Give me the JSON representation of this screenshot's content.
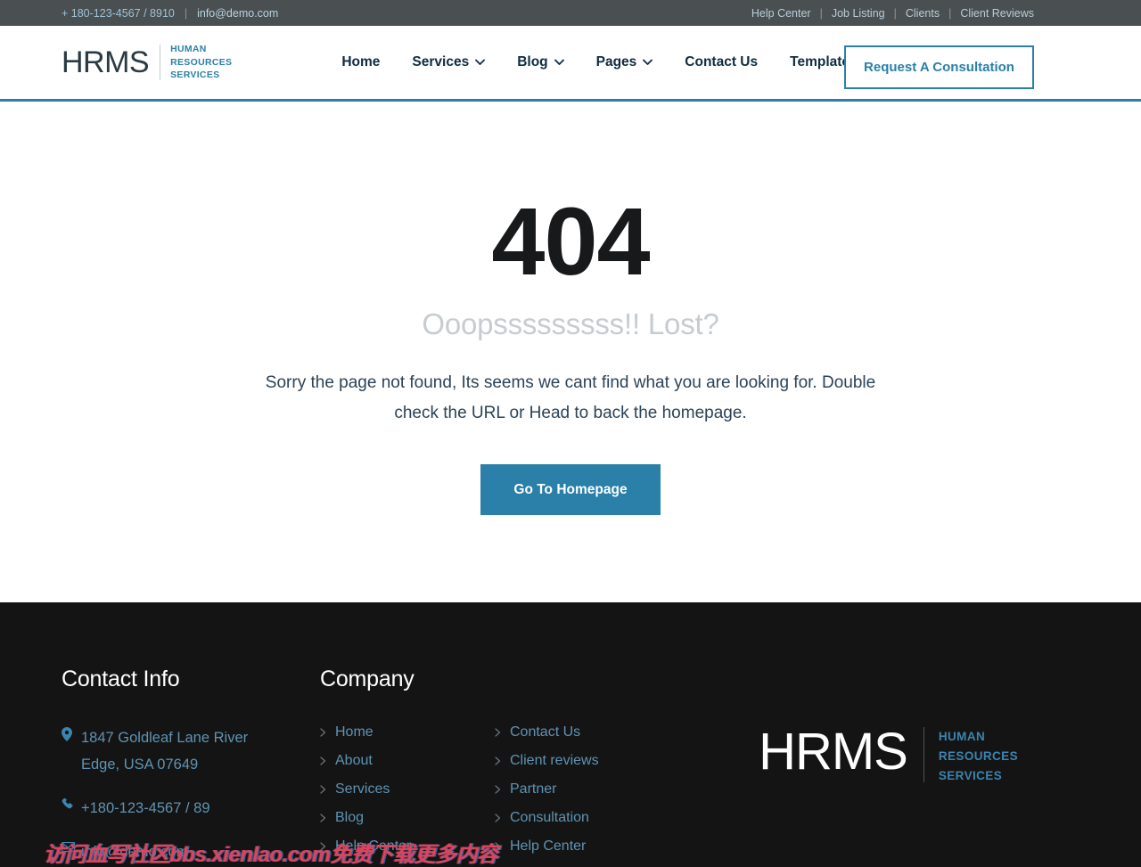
{
  "topbar": {
    "phone": "+ 180-123-4567 / 8910",
    "email": "info@demo.com",
    "separator": "|",
    "links": [
      {
        "label": "Help Center"
      },
      {
        "label": "Job Listing"
      },
      {
        "label": "Clients"
      },
      {
        "label": "Client Reviews"
      }
    ]
  },
  "header": {
    "logo": {
      "mark": "HRMS",
      "line1": "HUMAN",
      "line2": "RESOURCES",
      "line3": "SERVICES"
    },
    "nav": [
      {
        "label": "Home",
        "caret": false
      },
      {
        "label": "Services",
        "caret": true,
        "caret_icon": "chevron-down-icon"
      },
      {
        "label": "Blog",
        "caret": true,
        "caret_icon": "chevron-down-icon"
      },
      {
        "label": "Pages",
        "caret": true,
        "caret_icon": "chevron-down-icon"
      },
      {
        "label": "Contact Us",
        "caret": false
      },
      {
        "label": "Template Feature",
        "caret": false
      }
    ],
    "cta_label": "Request A Consultation",
    "accent_color": "#2a80a8"
  },
  "main": {
    "error_code": "404",
    "subtitle": "Ooopsssssssss!! Lost?",
    "description": "Sorry the page not found, Its seems we cant find what you are looking for. Double check the URL or Head to back the homepage.",
    "button_label": "Go To Homepage",
    "button_color": "#2a80a8"
  },
  "footer": {
    "background": "#141414",
    "contact": {
      "title": "Contact Info",
      "address": "1847 Goldleaf Lane River Edge, USA 07649",
      "phone": "+180-123-4567 / 89",
      "email": "info@demo.com",
      "address_icon": "map-pin-icon",
      "phone_icon": "phone-icon",
      "email_icon": "envelope-icon"
    },
    "company": {
      "title": "Company",
      "column_one": [
        {
          "label": "Home"
        },
        {
          "label": "About"
        },
        {
          "label": "Services"
        },
        {
          "label": "Blog"
        },
        {
          "label": "Help Center"
        }
      ],
      "column_two": [
        {
          "label": "Contact Us"
        },
        {
          "label": "Client reviews"
        },
        {
          "label": "Partner"
        },
        {
          "label": "Consultation"
        },
        {
          "label": "Help Center"
        }
      ]
    },
    "logo": {
      "mark": "HRMS",
      "line1": "HUMAN",
      "line2": "RESOURCES",
      "line3": "SERVICES"
    }
  },
  "watermark": {
    "text": "访问血写社区bbs.xienlao.com免费下载更多内容",
    "color": "#d9455f"
  }
}
